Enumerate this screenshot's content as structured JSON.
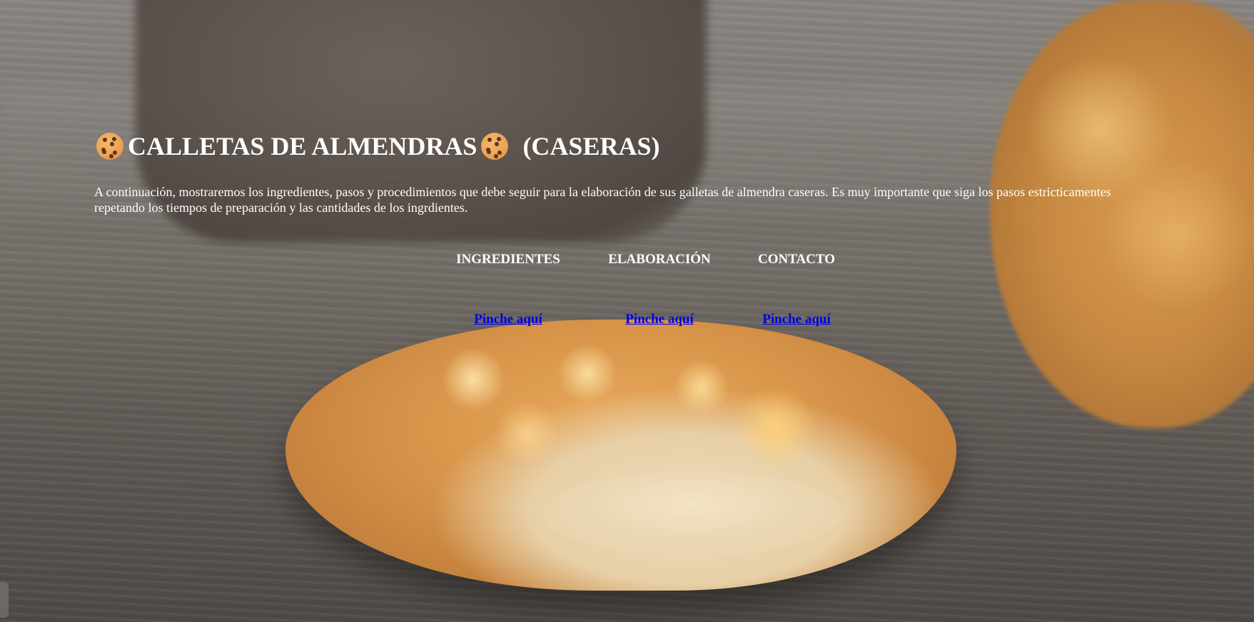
{
  "header": {
    "title_main": "CALLETAS DE ALMENDRAS",
    "title_suffix": "(CASERAS)",
    "icon": "cookie-icon"
  },
  "intro": {
    "text": "A continuación, mostraremos los ingredientes, pasos y procedimientos que debe seguir para la elaboración de sus galletas de almendra caseras. Es muy importante que siga los pasos estricticamentes repetando los tiempos de preparación y las cantidades de los ingrdientes."
  },
  "nav": {
    "sections": [
      {
        "label": "INGREDIENTES",
        "link": "Pinche aquí"
      },
      {
        "label": "ELABORACIÓN",
        "link": "Pinche aquí"
      },
      {
        "label": "CONTACTO",
        "link": "Pinche aquí"
      }
    ]
  },
  "colors": {
    "text": "#ffffff",
    "link": "#0000ee"
  }
}
